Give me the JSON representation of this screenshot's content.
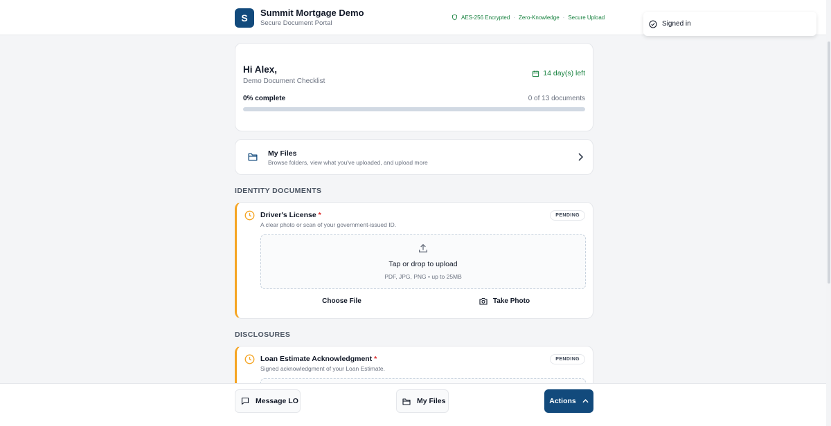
{
  "header": {
    "logo_letter": "S",
    "app_name": "Summit Mortgage Demo",
    "app_sub": "Secure Document Portal",
    "security": [
      "AES-256 Encrypted",
      "Zero-Knowledge",
      "Secure Upload"
    ],
    "separator": "·"
  },
  "toast": {
    "message": "Signed in"
  },
  "welcome": {
    "greeting": "Hi Alex,",
    "checklist": "Demo Document Checklist",
    "days_left": "14 day(s) left",
    "percent_label": "0% complete",
    "count_label": "0 of 13 documents",
    "progress": 0
  },
  "my_files": {
    "title": "My Files",
    "description": "Browse folders, view what you've uploaded, and upload more"
  },
  "sections": [
    {
      "label": "IDENTITY DOCUMENTS",
      "document": {
        "title": "Driver's License",
        "required_mark": "*",
        "description": "A clear photo or scan of your government-issued ID.",
        "status": "PENDING",
        "drop_title": "Tap or drop to upload",
        "drop_sub": "PDF, JPG, PNG • up to 25MB",
        "choose_label": "Choose File",
        "photo_label": "Take Photo"
      }
    },
    {
      "label": "DISCLOSURES",
      "document": {
        "title": "Loan Estimate Acknowledgment",
        "required_mark": "*",
        "description": "Signed acknowledgment of your Loan Estimate.",
        "status": "PENDING"
      }
    }
  ],
  "bottom_bar": {
    "message_label": "Message LO",
    "files_label": "My Files",
    "actions_label": "Actions"
  },
  "colors": {
    "brand": "#124a7c",
    "success": "#15803d",
    "pending": "#f5a524",
    "required": "#dc2626"
  },
  "icons": [
    "shield-icon",
    "check-circle-icon",
    "calendar-icon",
    "folder-icon",
    "chevron-right-icon",
    "clock-icon",
    "upload-icon",
    "camera-icon",
    "message-icon",
    "chevron-up-icon"
  ]
}
